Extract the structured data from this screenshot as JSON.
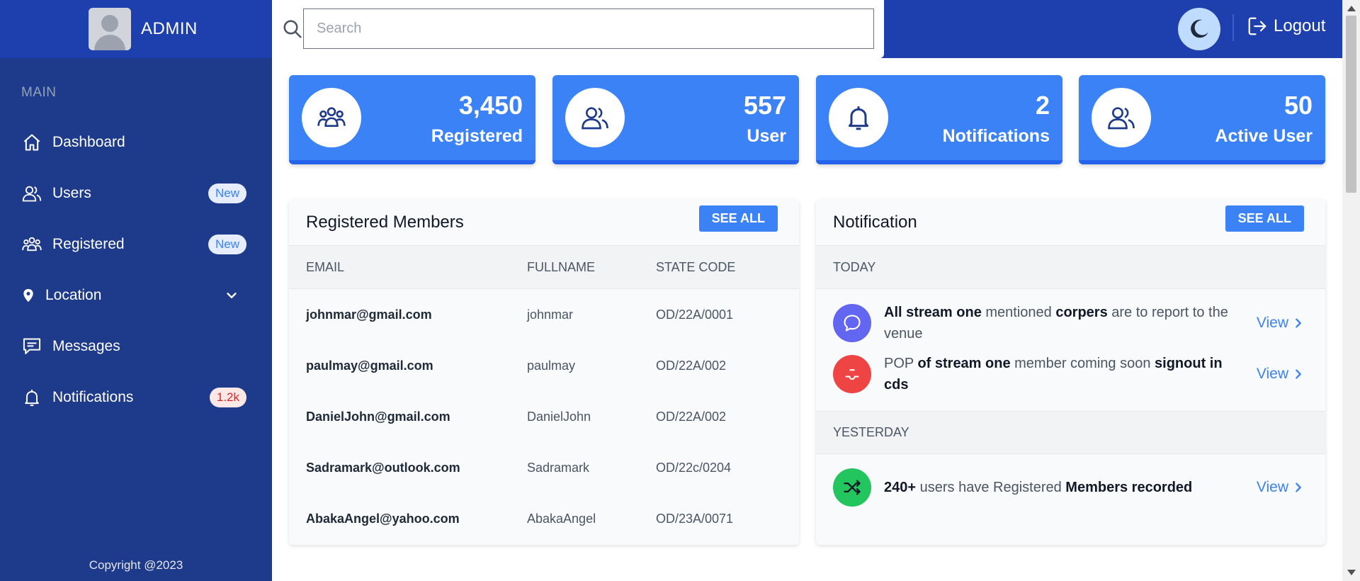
{
  "sidebar": {
    "brand": "ADMIN",
    "section_label": "MAIN",
    "items": [
      {
        "label": "Dashboard"
      },
      {
        "label": "Users",
        "badge": "New"
      },
      {
        "label": "Registered",
        "badge": "New"
      },
      {
        "label": "Location"
      },
      {
        "label": "Messages"
      },
      {
        "label": "Notifications",
        "badge": "1.2k"
      }
    ],
    "copyright": "Copyright @2023"
  },
  "topbar": {
    "search_placeholder": "Search",
    "logout_label": "Logout"
  },
  "stats": [
    {
      "value": "3,450",
      "label": "Registered",
      "icon": "users-group-icon"
    },
    {
      "value": "557",
      "label": "User",
      "icon": "users-icon"
    },
    {
      "value": "2",
      "label": "Notifications",
      "icon": "bell-icon"
    },
    {
      "value": "50",
      "label": "Active User",
      "icon": "users-icon"
    }
  ],
  "members": {
    "title": "Registered Members",
    "see_all": "SEE ALL",
    "columns": [
      "EMAIL",
      "FULLNAME",
      "STATE CODE"
    ],
    "rows": [
      {
        "email": "johnmar@gmail.com",
        "name": "johnmar",
        "code": "OD/22A/0001"
      },
      {
        "email": "paulmay@gmail.com",
        "name": "paulmay",
        "code": "OD/22A/002"
      },
      {
        "email": "DanielJohn@gmail.com",
        "name": "DanielJohn",
        "code": "OD/22A/002"
      },
      {
        "email": "Sadramark@outlook.com",
        "name": "Sadramark",
        "code": "OD/22c/0204"
      },
      {
        "email": "AbakaAngel@yahoo.com",
        "name": "AbakaAngel",
        "code": "OD/23A/0071"
      }
    ]
  },
  "notifications": {
    "title": "Notification",
    "see_all": "SEE ALL",
    "today_label": "TODAY",
    "yesterday_label": "YESTERDAY",
    "view_label": "View",
    "items": [
      {
        "p1": "All stream one",
        "p2": " mentioned ",
        "p3": "corpers",
        "p4": " are to report to the venue"
      },
      {
        "p1": "POP ",
        "p2": "of stream one",
        "p3": " member coming soon ",
        "p4": "signout in cds"
      },
      {
        "p1": "240+",
        "p2": " users have Registered ",
        "p3": "Members recorded"
      }
    ]
  },
  "colors": {
    "sidebar": "#1e3a8a",
    "topbar": "#1e40af",
    "accent": "#3b82f6",
    "notif_purple": "#6366f1",
    "notif_red": "#ef4444",
    "notif_green": "#22c55e"
  }
}
